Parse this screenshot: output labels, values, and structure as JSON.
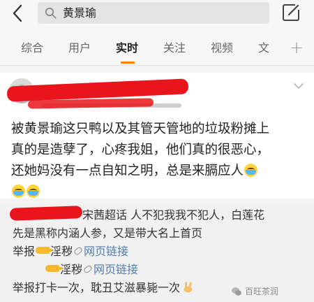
{
  "search": {
    "query": "黄景瑜"
  },
  "tabs": [
    {
      "label": "综合",
      "active": false
    },
    {
      "label": "用户",
      "active": false
    },
    {
      "label": "实时",
      "active": true
    },
    {
      "label": "关注",
      "active": false
    },
    {
      "label": "视频",
      "active": false
    },
    {
      "label": "文",
      "active": false
    }
  ],
  "post": {
    "lines": [
      "被黄景瑜这只鸭以及其管天管地的垃圾粉摊上",
      "真的是造孽了，心疼我姐，他们真的很恶心，",
      "还她妈没有一点自知之明，总是来膈应人"
    ],
    "emoji": "crying-face"
  },
  "comment": {
    "line1": "宋茜超话 人不犯我我不犯人，白莲花",
    "line2": "先是黑称内涵人参，又是带大名上首页",
    "report_label": "举报",
    "tag": "淫秽",
    "link_text": "网页链接",
    "line5": "举报打卡一次，耽丑艾滋暴毙一次"
  },
  "watermark": {
    "text": "百旺茶润"
  },
  "colors": {
    "accent": "#ff8200",
    "link": "#507daf",
    "redaction": "#e8161c"
  }
}
